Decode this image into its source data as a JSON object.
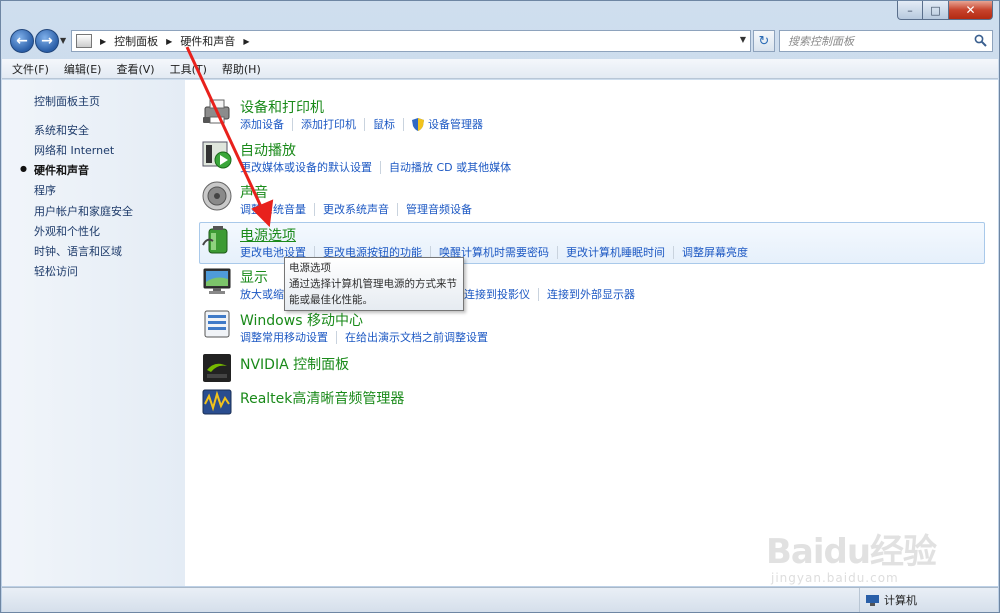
{
  "window": {
    "minimize": "–",
    "maximize": "□",
    "close": "✕"
  },
  "address": {
    "crumbs": [
      "控制面板",
      "硬件和声音"
    ],
    "search_placeholder": "搜索控制面板"
  },
  "menu": [
    "文件(F)",
    "编辑(E)",
    "查看(V)",
    "工具(T)",
    "帮助(H)"
  ],
  "sidebar": {
    "items": [
      {
        "label": "控制面板主页",
        "active": false
      },
      {
        "label": "系统和安全",
        "active": false
      },
      {
        "label": "网络和 Internet",
        "active": false
      },
      {
        "label": "硬件和声音",
        "active": true
      },
      {
        "label": "程序",
        "active": false
      },
      {
        "label": "用户帐户和家庭安全",
        "active": false
      },
      {
        "label": "外观和个性化",
        "active": false
      },
      {
        "label": "时钟、语言和区域",
        "active": false
      },
      {
        "label": "轻松访问",
        "active": false
      }
    ]
  },
  "categories": [
    {
      "title": "设备和打印机",
      "icon": "printer-icon",
      "links": [
        "添加设备",
        "添加打印机",
        "鼠标",
        "设备管理器"
      ]
    },
    {
      "title": "自动播放",
      "icon": "autoplay-icon",
      "links": [
        "更改媒体或设备的默认设置",
        "自动播放 CD 或其他媒体"
      ]
    },
    {
      "title": "声音",
      "icon": "speaker-icon",
      "links": [
        "调整系统音量",
        "更改系统声音",
        "管理音频设备"
      ]
    },
    {
      "title": "电源选项",
      "icon": "battery-icon",
      "links": [
        "更改电池设置",
        "更改电源按钮的功能",
        "唤醒计算机时需要密码",
        "更改计算机睡眠时间",
        "调整屏幕亮度"
      ]
    },
    {
      "title": "显示",
      "icon": "monitor-icon",
      "links": [
        "放大或缩",
        "连接到投影仪",
        "连接到外部显示器"
      ]
    },
    {
      "title": "Windows 移动中心",
      "icon": "mobility-center-icon",
      "links": [
        "调整常用移动设置",
        "在给出演示文档之前调整设置"
      ]
    },
    {
      "title": "NVIDIA 控制面板",
      "icon": "nvidia-icon",
      "links": []
    },
    {
      "title": "Realtek高清晰音频管理器",
      "icon": "realtek-icon",
      "links": []
    }
  ],
  "tooltip": {
    "title": "电源选项",
    "text1": "通过选择计算机管理电源的方式来节",
    "text2": "能或最佳化性能。"
  },
  "status": {
    "location": "计算机"
  },
  "watermark": {
    "logo": "Baidu经验",
    "sub": "jingyan.baidu.com"
  },
  "colors": {
    "category_title": "#1a8a1a",
    "link": "#1c58c3",
    "arrow": "#e8211c"
  }
}
